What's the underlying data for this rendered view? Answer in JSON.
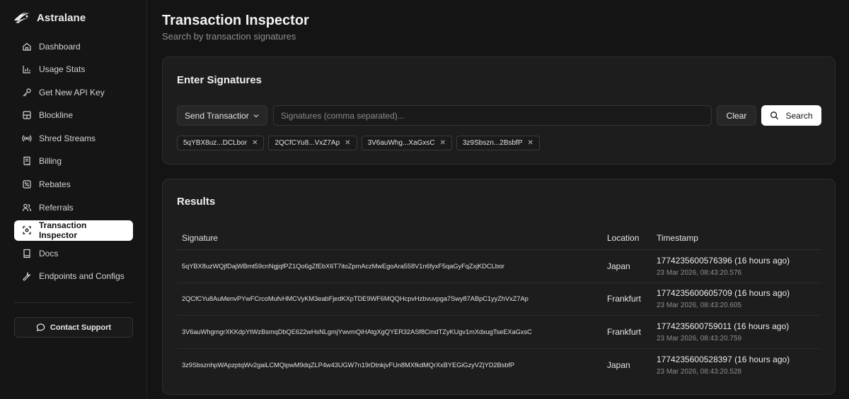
{
  "brand": {
    "name": "Astralane"
  },
  "sidebar": {
    "items": [
      {
        "label": "Dashboard",
        "icon": "home-icon"
      },
      {
        "label": "Usage Stats",
        "icon": "bar-chart-icon"
      },
      {
        "label": "Get New API Key",
        "icon": "key-icon"
      },
      {
        "label": "Blockline",
        "icon": "blocks-icon"
      },
      {
        "label": "Shred Streams",
        "icon": "radio-icon"
      },
      {
        "label": "Billing",
        "icon": "receipt-icon"
      },
      {
        "label": "Rebates",
        "icon": "rebate-icon"
      },
      {
        "label": "Referrals",
        "icon": "users-icon"
      },
      {
        "label": "Transaction Inspector",
        "icon": "scan-icon",
        "active": true
      },
      {
        "label": "Docs",
        "icon": "docs-icon"
      },
      {
        "label": "Endpoints and Configs",
        "icon": "wrench-icon"
      }
    ],
    "support_label": "Contact Support"
  },
  "header": {
    "title": "Transaction Inspector",
    "subtitle": "Search by transaction signatures"
  },
  "signatures_card": {
    "title": "Enter Signatures",
    "select_value": "Send Transactior",
    "input_placeholder": "Signatures (comma separated)...",
    "clear_label": "Clear",
    "search_label": "Search",
    "chips": [
      "5qYBX8uz...DCLbor",
      "2QCfCYu8...VxZ7Ap",
      "3V6auWhg...XaGxsC",
      "3z9Sbszn...2BsbfP"
    ]
  },
  "results": {
    "title": "Results",
    "columns": {
      "signature": "Signature",
      "location": "Location",
      "timestamp": "Timestamp"
    },
    "rows": [
      {
        "signature": "5qYBX8uzWQjfDajWBmt59cnNgjqfPZ1Qo6gZfEbX6T7itoZpmAczMwEgoAra558V1n6fyxF5qaGyFqZxjKDCLbor",
        "location": "Japan",
        "timestamp": "1774235600576396 (16 hours ago)",
        "date": "23 Mar 2026, 08:43:20.576"
      },
      {
        "signature": "2QCfCYu8AuMenvPYwFCrcoMufvHMCVyKM3eabFjedKXpTDE9WF6MQQHcpvHzbvuvpga7Swy87ABpC1yyZhVxZ7Ap",
        "location": "Frankfurt",
        "timestamp": "1774235600605709 (16 hours ago)",
        "date": "23 Mar 2026, 08:43:20.605"
      },
      {
        "signature": "3V6auWhgmgrXKKdpYtWzBsmqDbQE622wHsNLgmjYwvmQiHAtgXgQYER32ASf8CmdTZyKUgv1mXdxugTseEXaGxsC",
        "location": "Frankfurt",
        "timestamp": "1774235600759011 (16 hours ago)",
        "date": "23 Mar 2026, 08:43:20.759"
      },
      {
        "signature": "3z9SbsznhpWApzptqWv2gaiLCMQipwM9dqZLP4w43UGW7n19rDtnkjvFUn8MXfkdMQrXxBYEGiGzyVZjYD2BsbfP",
        "location": "Japan",
        "timestamp": "1774235600528397 (16 hours ago)",
        "date": "23 Mar 2026, 08:43:20.528"
      }
    ]
  },
  "colors": {
    "background": "#141414",
    "card": "#1d1d1d",
    "active_nav": "#ffffff",
    "accent_button": "#ffffff"
  }
}
